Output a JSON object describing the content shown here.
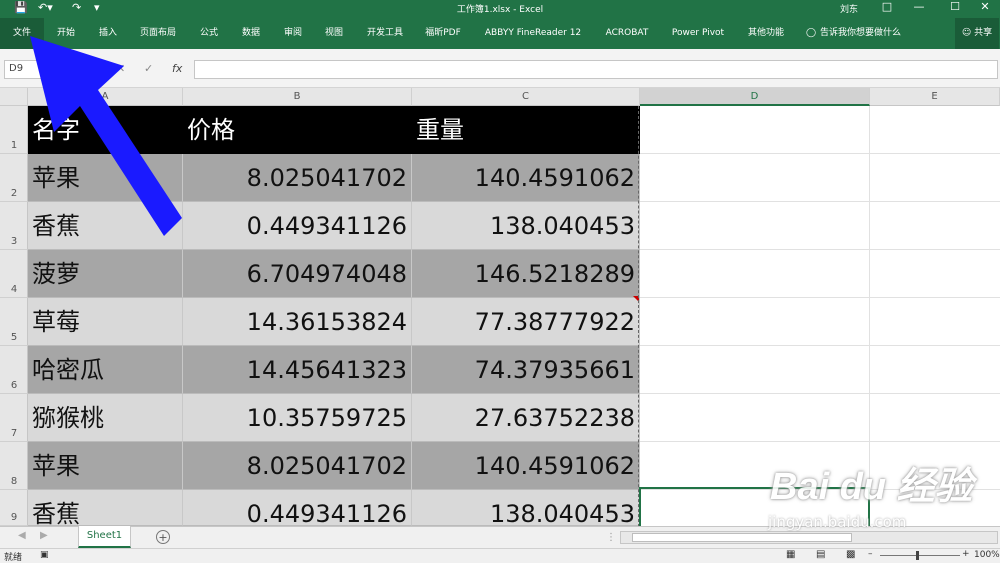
{
  "window": {
    "title": "工作簿1.xlsx  -  Excel",
    "user": "刘东"
  },
  "ribbon": {
    "tabs": [
      "文件",
      "开始",
      "插入",
      "页面布局",
      "公式",
      "数据",
      "审阅",
      "视图",
      "开发工具",
      "福昕PDF",
      "ABBYY FineReader 12",
      "ACROBAT",
      "Power Pivot",
      "其他功能"
    ],
    "tell_me": "告诉我你想要做什么",
    "share": "共享"
  },
  "formula_bar": {
    "name_box": "D9",
    "fx": "fx",
    "value": ""
  },
  "columns": [
    "A",
    "B",
    "C",
    "D",
    "E"
  ],
  "rows": [
    "1",
    "2",
    "3",
    "4",
    "5",
    "6",
    "7",
    "8",
    "9"
  ],
  "table": {
    "header": [
      "名字",
      "价格",
      "重量"
    ],
    "data": [
      [
        "苹果",
        "8.025041702",
        "140.4591062"
      ],
      [
        "香蕉",
        "0.449341126",
        "138.040453"
      ],
      [
        "菠萝",
        "6.704974048",
        "146.5218289"
      ],
      [
        "草莓",
        "14.36153824",
        "77.38777922"
      ],
      [
        "哈密瓜",
        "14.45641323",
        "74.37935661"
      ],
      [
        "猕猴桃",
        "10.35759725",
        "27.63752238"
      ],
      [
        "苹果",
        "8.025041702",
        "140.4591062"
      ],
      [
        "香蕉",
        "0.449341126",
        "138.040453"
      ]
    ]
  },
  "sheets": [
    "Sheet1"
  ],
  "status": {
    "mode": "就绪",
    "zoom": "100%"
  },
  "colors": {
    "excel_green": "#217346",
    "arrow_blue": "#1a1aff"
  },
  "watermark": {
    "logo": "Bai du 经验",
    "url": "jingyan.baidu.com"
  }
}
